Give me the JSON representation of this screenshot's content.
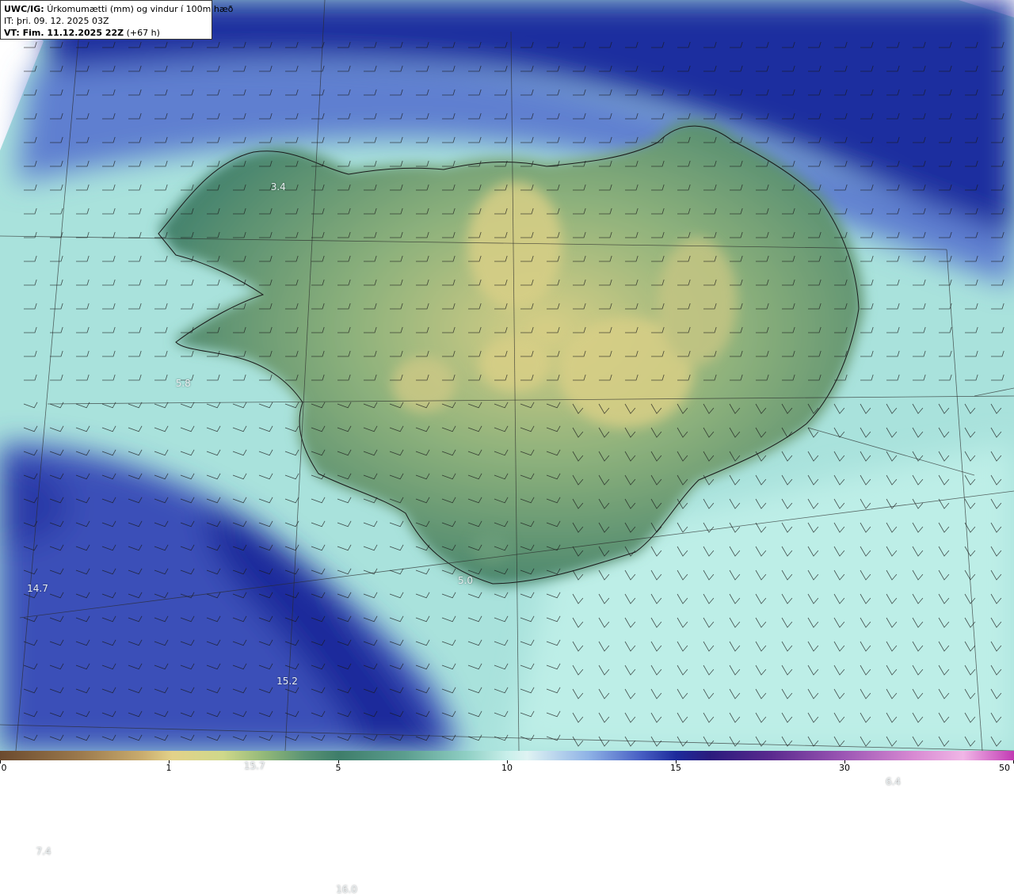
{
  "header": {
    "model": "UWC/IG:",
    "field": "Úrkomumætti (mm) og vindur í 100m hæð",
    "initial_time": "IT: þri. 09. 12. 2025 03Z",
    "valid_label": "VT: Fim. 11.12.2025 22Z",
    "lead_time": "(+67 h)"
  },
  "map_labels": [
    {
      "id": "v1",
      "text": "3.4",
      "lon": -22.35,
      "lat": 66.1
    },
    {
      "id": "v2",
      "text": "5.8",
      "lon": -23.95,
      "lat": 64.83
    },
    {
      "id": "v3",
      "text": "14.7",
      "lon": -26.4,
      "lat": 63.5
    },
    {
      "id": "v4",
      "text": "5.0",
      "lon": -19.2,
      "lat": 63.55
    },
    {
      "id": "v5",
      "text": "15.2",
      "lon": -22.2,
      "lat": 62.9
    },
    {
      "id": "v6",
      "text": "15.7",
      "lon": -22.75,
      "lat": 62.35
    },
    {
      "id": "v7",
      "text": "16.0",
      "lon": -21.2,
      "lat": 61.55
    },
    {
      "id": "v8",
      "text": "6.4",
      "lon": -12.0,
      "lat": 62.25
    },
    {
      "id": "v9",
      "text": "7.4",
      "lon": -26.3,
      "lat": 61.8
    }
  ],
  "colorbar": {
    "unit": "mm",
    "ticks": [
      "0",
      "1",
      "5",
      "10",
      "15",
      "30",
      "50"
    ]
  },
  "colors": {
    "land_low": "#3f7f6c",
    "land_high": "#d8cf86",
    "ocean_light": "#bfeee8",
    "ocean_blue": "#4a62c5",
    "ocean_deep": "#1d2a9b"
  }
}
